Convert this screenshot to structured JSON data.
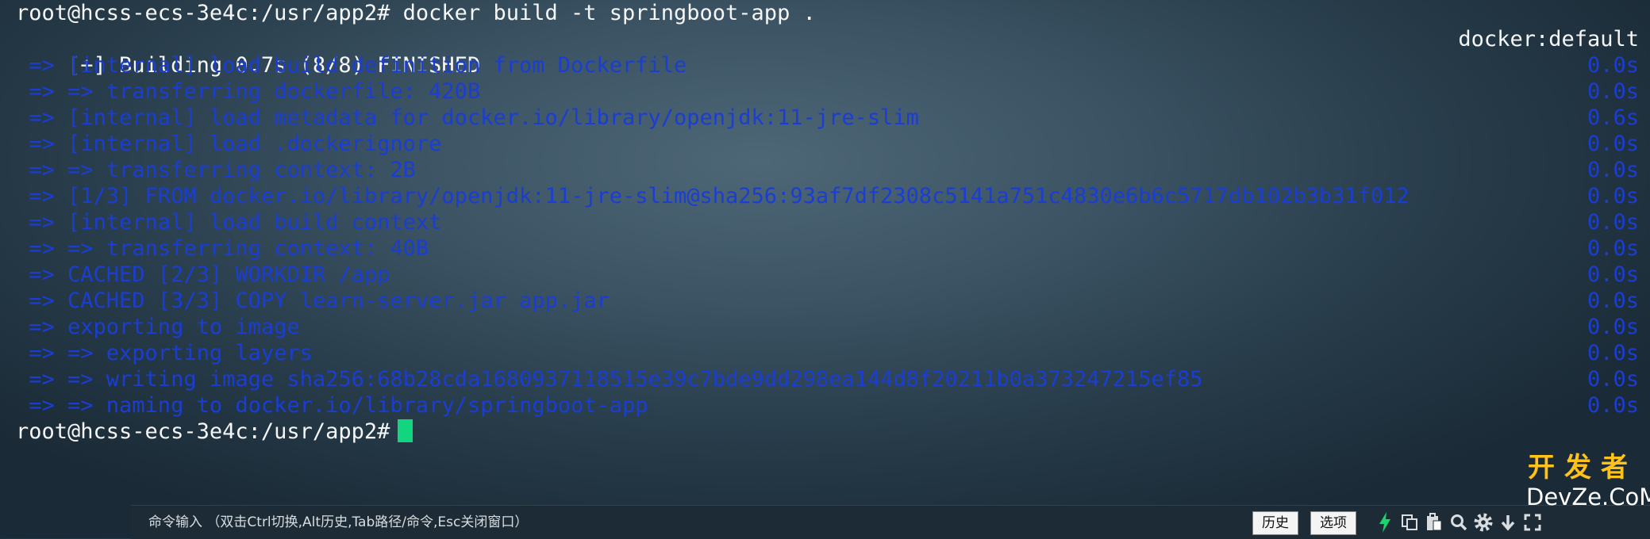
{
  "terminal": {
    "command_line": "root@hcss-ecs-3e4c:/usr/app2# docker build -t springboot-app .",
    "build_status": "[+] Building 0.7s (8/8) FINISHED",
    "build_context": "docker:default",
    "steps": [
      {
        "text": " => [internal] load build definition from Dockerfile",
        "time": "0.0s"
      },
      {
        "text": " => => transferring dockerfile: 420B",
        "time": "0.0s"
      },
      {
        "text": " => [internal] load metadata for docker.io/library/openjdk:11-jre-slim",
        "time": "0.6s"
      },
      {
        "text": " => [internal] load .dockerignore",
        "time": "0.0s"
      },
      {
        "text": " => => transferring context: 2B",
        "time": "0.0s"
      },
      {
        "text": " => [1/3] FROM docker.io/library/openjdk:11-jre-slim@sha256:93af7df2308c5141a751c4830e6b6c5717db102b3b31f012",
        "time": "0.0s"
      },
      {
        "text": " => [internal] load build context",
        "time": "0.0s"
      },
      {
        "text": " => => transferring context: 40B",
        "time": "0.0s"
      },
      {
        "text": " => CACHED [2/3] WORKDIR /app",
        "time": "0.0s"
      },
      {
        "text": " => CACHED [3/3] COPY learn-server.jar app.jar",
        "time": "0.0s"
      },
      {
        "text": " => exporting to image",
        "time": "0.0s"
      },
      {
        "text": " => => exporting layers",
        "time": "0.0s"
      },
      {
        "text": " => => writing image sha256:68b28cda1680937118515e39c7bde9dd298ea144d8f20211b0a373247215ef85",
        "time": "0.0s"
      },
      {
        "text": " => => naming to docker.io/library/springboot-app",
        "time": "0.0s"
      }
    ],
    "prompt": "root@hcss-ecs-3e4c:/usr/app2#"
  },
  "statusbar": {
    "hint": "命令输入 （双击Ctrl切换,Alt历史,Tab路径/命令,Esc关闭窗口）",
    "history_button": "历史",
    "options_button": "选项",
    "icons": [
      "lightning-icon",
      "copy-icon",
      "paste-icon",
      "search-icon",
      "gear-icon",
      "download-icon",
      "expand-icon"
    ]
  },
  "watermark": {
    "top": "开发者",
    "bottom": "DevZe.CoM"
  },
  "colors": {
    "prompt_text": "#f4f6f7",
    "build_step_text": "#1a3dd4",
    "cursor": "#13d57f",
    "lightning": "#19d36f",
    "watermark_top": "#ffc21a"
  }
}
